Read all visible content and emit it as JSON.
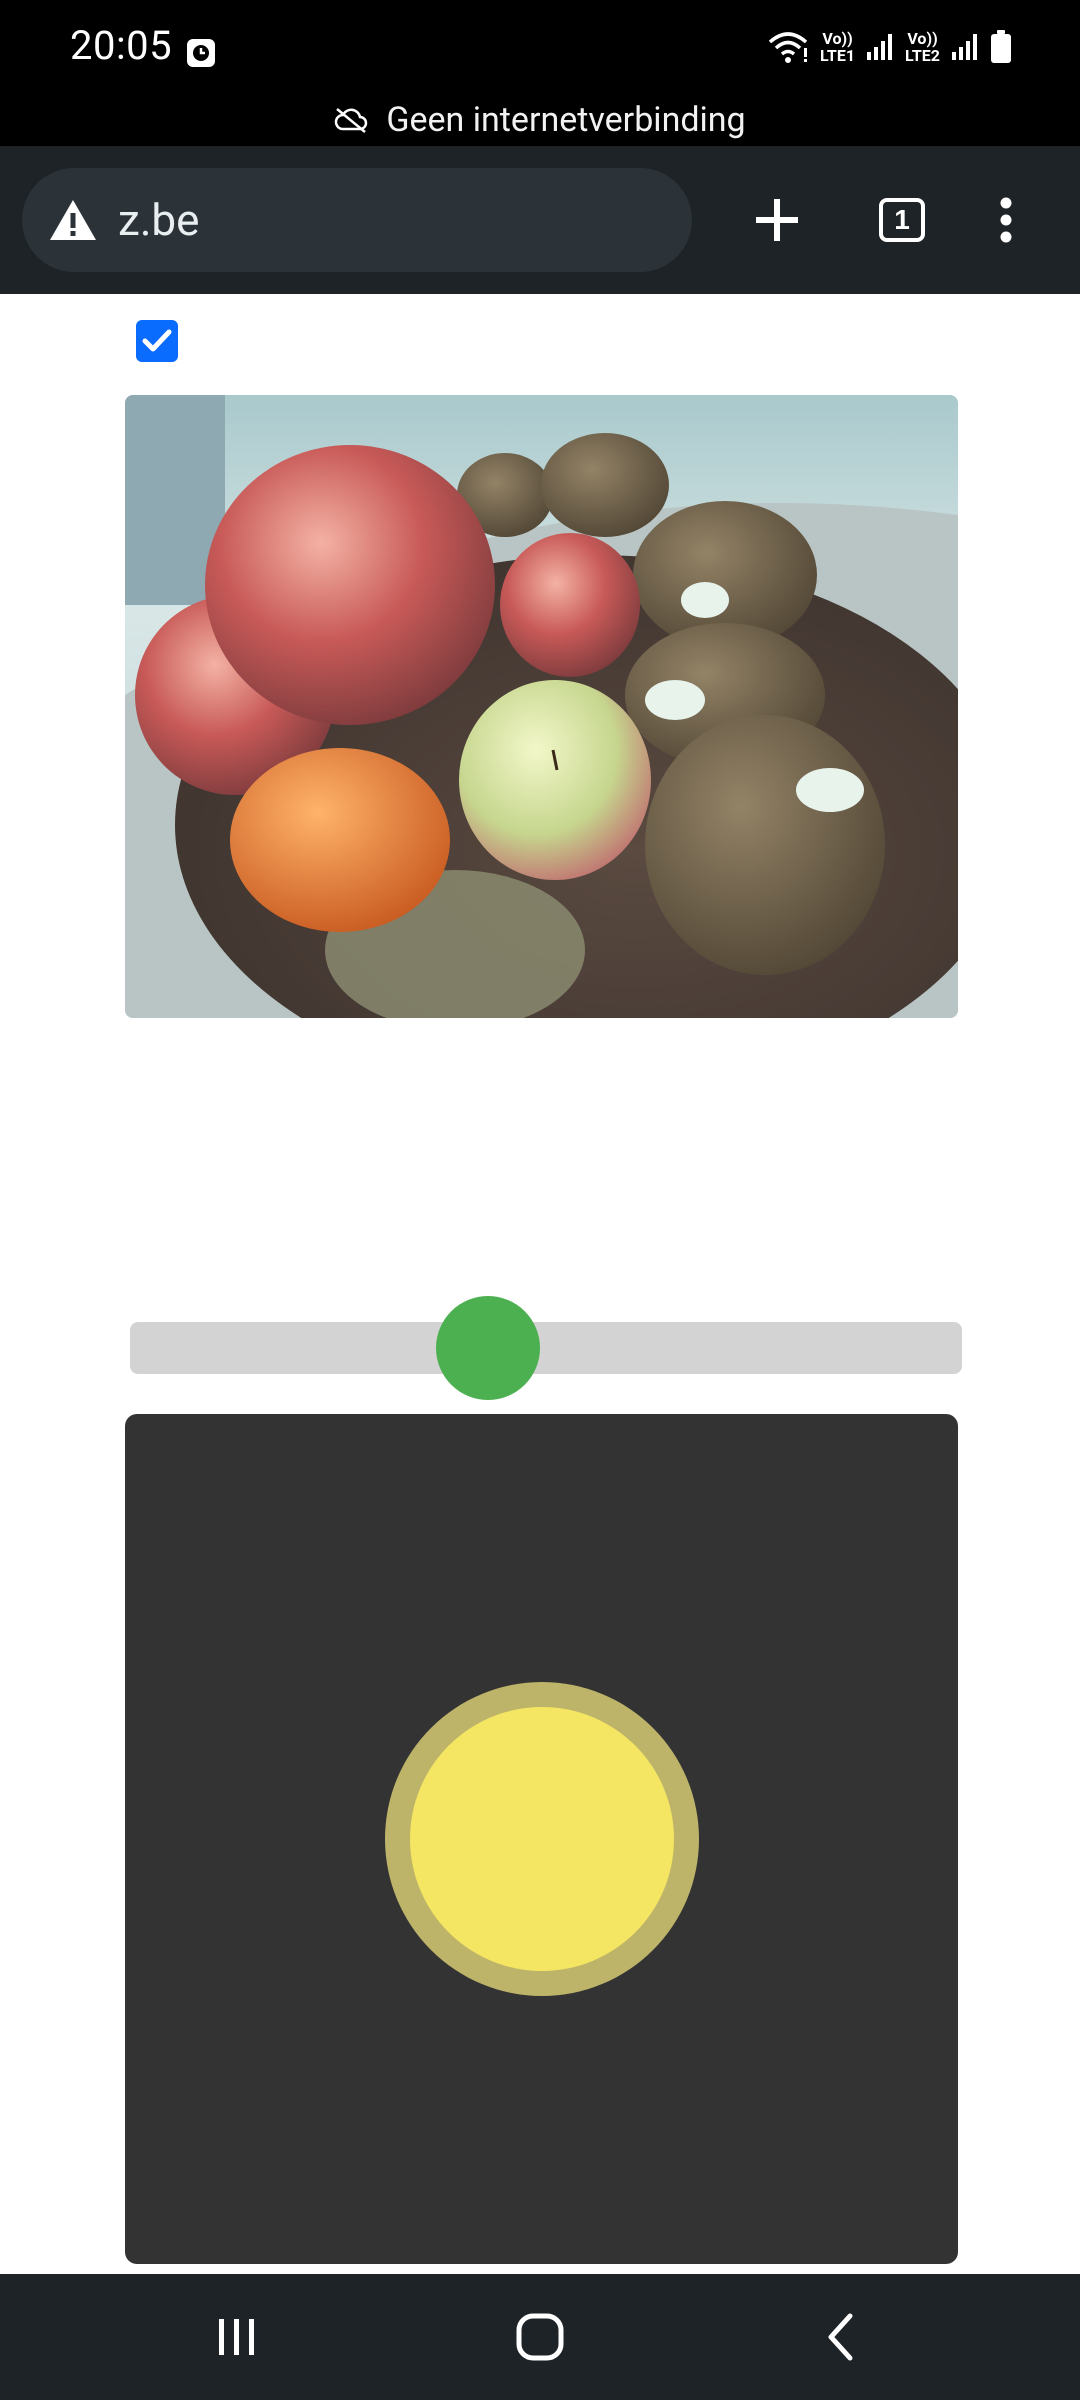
{
  "status_bar": {
    "time": "20:05",
    "lte1": "LTE1",
    "lte2": "LTE2",
    "volte": "Vo))",
    "offline_message": "Geen internetverbinding"
  },
  "browser": {
    "url": "z.be",
    "tab_count": "1",
    "icons": [
      "warning-icon",
      "new-tab-icon",
      "tab-switcher-icon",
      "more-options-icon"
    ]
  },
  "page": {
    "checkbox_checked": true,
    "camera_alt": "",
    "slider": {
      "value_fraction": 0.43
    },
    "joystick": {
      "x": 0.0,
      "y": 0.0
    }
  },
  "colors": {
    "checkbox": "#0a6cff",
    "slider_thumb": "#4caf50",
    "slider_track": "#d3d3d3",
    "joystick_pad": "#333333",
    "joystick_knob": "#f4e562",
    "joystick_ring": "#bdb46a"
  },
  "nav_bar": {
    "icons": [
      "recents-icon",
      "home-icon",
      "back-icon"
    ]
  }
}
